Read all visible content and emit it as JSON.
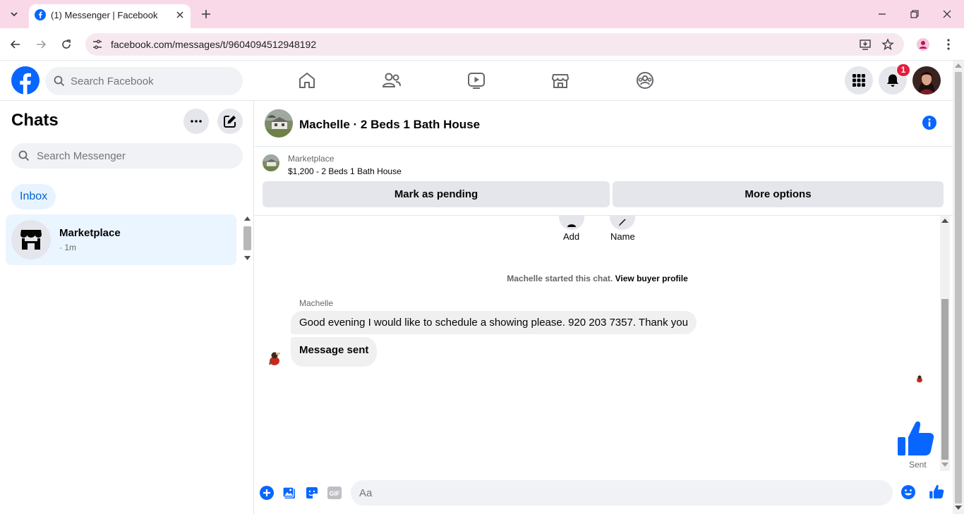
{
  "browser": {
    "tab_title": "(1) Messenger | Facebook",
    "url": "facebook.com/messages/t/9604094512948192"
  },
  "fb_header": {
    "search_placeholder": "Search Facebook",
    "notification_count": "1"
  },
  "sidebar": {
    "title": "Chats",
    "search_placeholder": "Search Messenger",
    "inbox_label": "Inbox",
    "chats": [
      {
        "name": "Marketplace",
        "time": "· 1m"
      }
    ]
  },
  "conversation": {
    "title": "Machelle · 2 Beds 1 Bath House",
    "listing": {
      "source": "Marketplace",
      "title": "$1,200 - 2 Beds 1 Bath House",
      "mark_pending_label": "Mark as pending",
      "more_options_label": "More options"
    },
    "partial_actions": [
      "Add",
      "Name"
    ],
    "system_text": "Machelle started this chat.",
    "system_link": "View buyer profile",
    "sender": "Machelle",
    "messages": [
      "Good evening I would like to schedule a showing please.  920 203 7357. Thank you",
      "Message sent"
    ],
    "sent_label": "Sent"
  },
  "composer": {
    "placeholder": "Aa",
    "gif_label": "GIF"
  },
  "colors": {
    "brand_blue": "#0866ff",
    "tab_strip": "#f9d9e8",
    "notification_red": "#e41e3f",
    "active_chat_bg": "#ebf5ff"
  }
}
